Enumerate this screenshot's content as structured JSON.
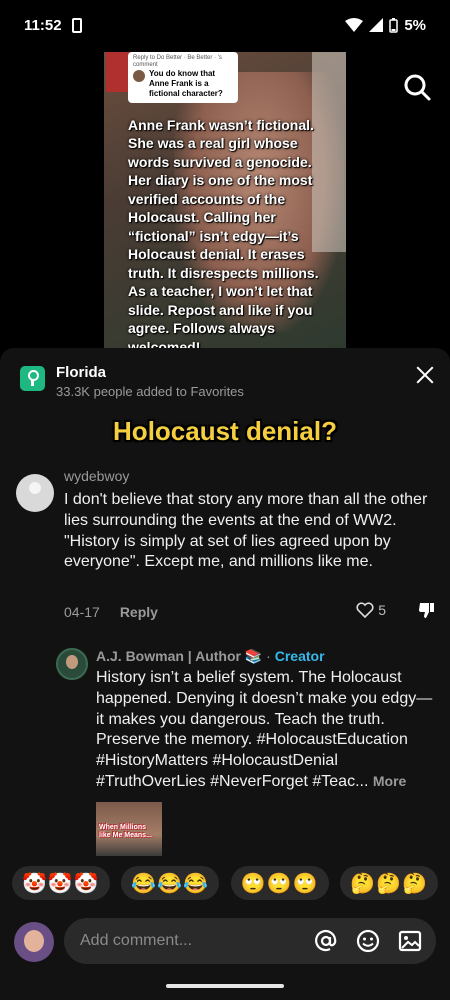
{
  "status_bar": {
    "time": "11:52",
    "battery": "5%"
  },
  "video": {
    "reply_card_header": "Reply to Do Better · Be Better · 's comment",
    "reply_card_text": "You do know that Anne Frank is a fictional character?",
    "caption": "Anne Frank wasn’t fictional. She was a real girl whose words survived a genocide. Her diary is one of the most verified accounts of the Holocaust. Calling her “fictional” isn’t edgy—it’s Holocaust denial. It erases truth. It disrespects millions. As a teacher, I won’t let that slide. Repost and like if you agree. Follows always welcomed!"
  },
  "place": {
    "name": "Florida",
    "subtitle": "33.3K people added to Favorites"
  },
  "overlay_title": "Holocaust denial?",
  "comment": {
    "username": "wydebwoy",
    "text": "I don't believe that story any more than all the other lies surrounding the events at the end of WW2. \"History is simply at set of lies agreed upon by everyone\". Except me, and millions like me.",
    "date": "04-17",
    "reply_label": "Reply",
    "likes": "5"
  },
  "reply": {
    "author": "A.J. Bowman | Author 📚",
    "separator": " · ",
    "badge": "Creator",
    "text": "History isn’t a belief system. The Holocaust happened. Denying it doesn’t make you edgy—it makes you dangerous. Teach the truth. Preserve the memory. #HolocaustEducation #HistoryMatters #HolocaustDenial #TruthOverLies #NeverForget #Teac...",
    "more_label": "More",
    "thumbnail_text": "When Millions like Me Means..."
  },
  "reactions": [
    "🤡🤡🤡",
    "😂😂😂",
    "🙄🙄🙄",
    "🤔🤔🤔"
  ],
  "compose": {
    "placeholder": "Add comment..."
  }
}
